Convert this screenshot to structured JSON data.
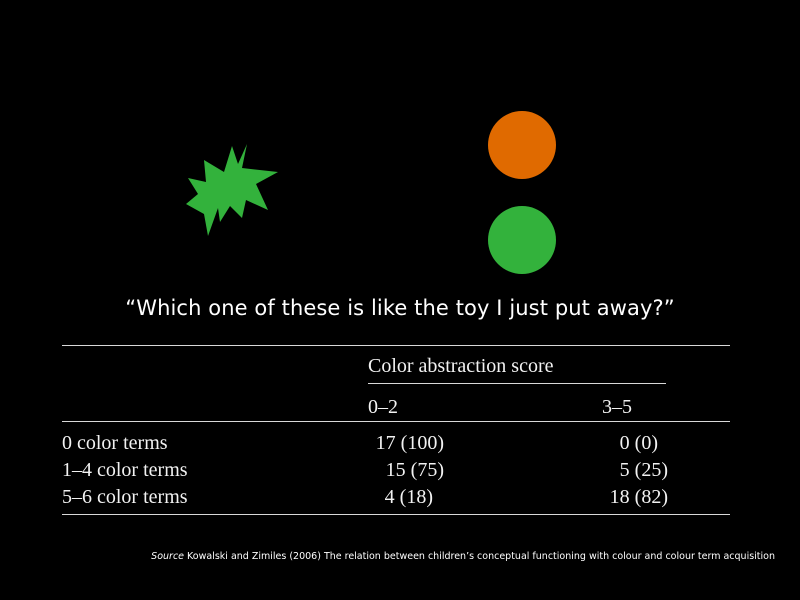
{
  "slide": {
    "shapes": {
      "starburst_color": "#33b23c",
      "orange_circle_color": "#e06a00",
      "green_circle_color": "#33b23c"
    },
    "question": "“Which one of these is like the toy I just put away?”",
    "table": {
      "group_header": "Color abstraction score",
      "column_headers": [
        "0–2",
        "3–5"
      ],
      "rows": [
        {
          "label": "0 color terms",
          "values": [
            "17 (100)",
            "0 (0)"
          ]
        },
        {
          "label": "1–4 color terms",
          "values": [
            "15 (75)",
            "5 (25)"
          ]
        },
        {
          "label": "5–6 color terms",
          "values": [
            "4 (18)",
            "18 (82)"
          ]
        }
      ]
    },
    "source": {
      "label": "Source",
      "text": " Kowalski and Zimiles (2006) The relation between children’s conceptual functioning with colour and colour term acquisition"
    }
  }
}
